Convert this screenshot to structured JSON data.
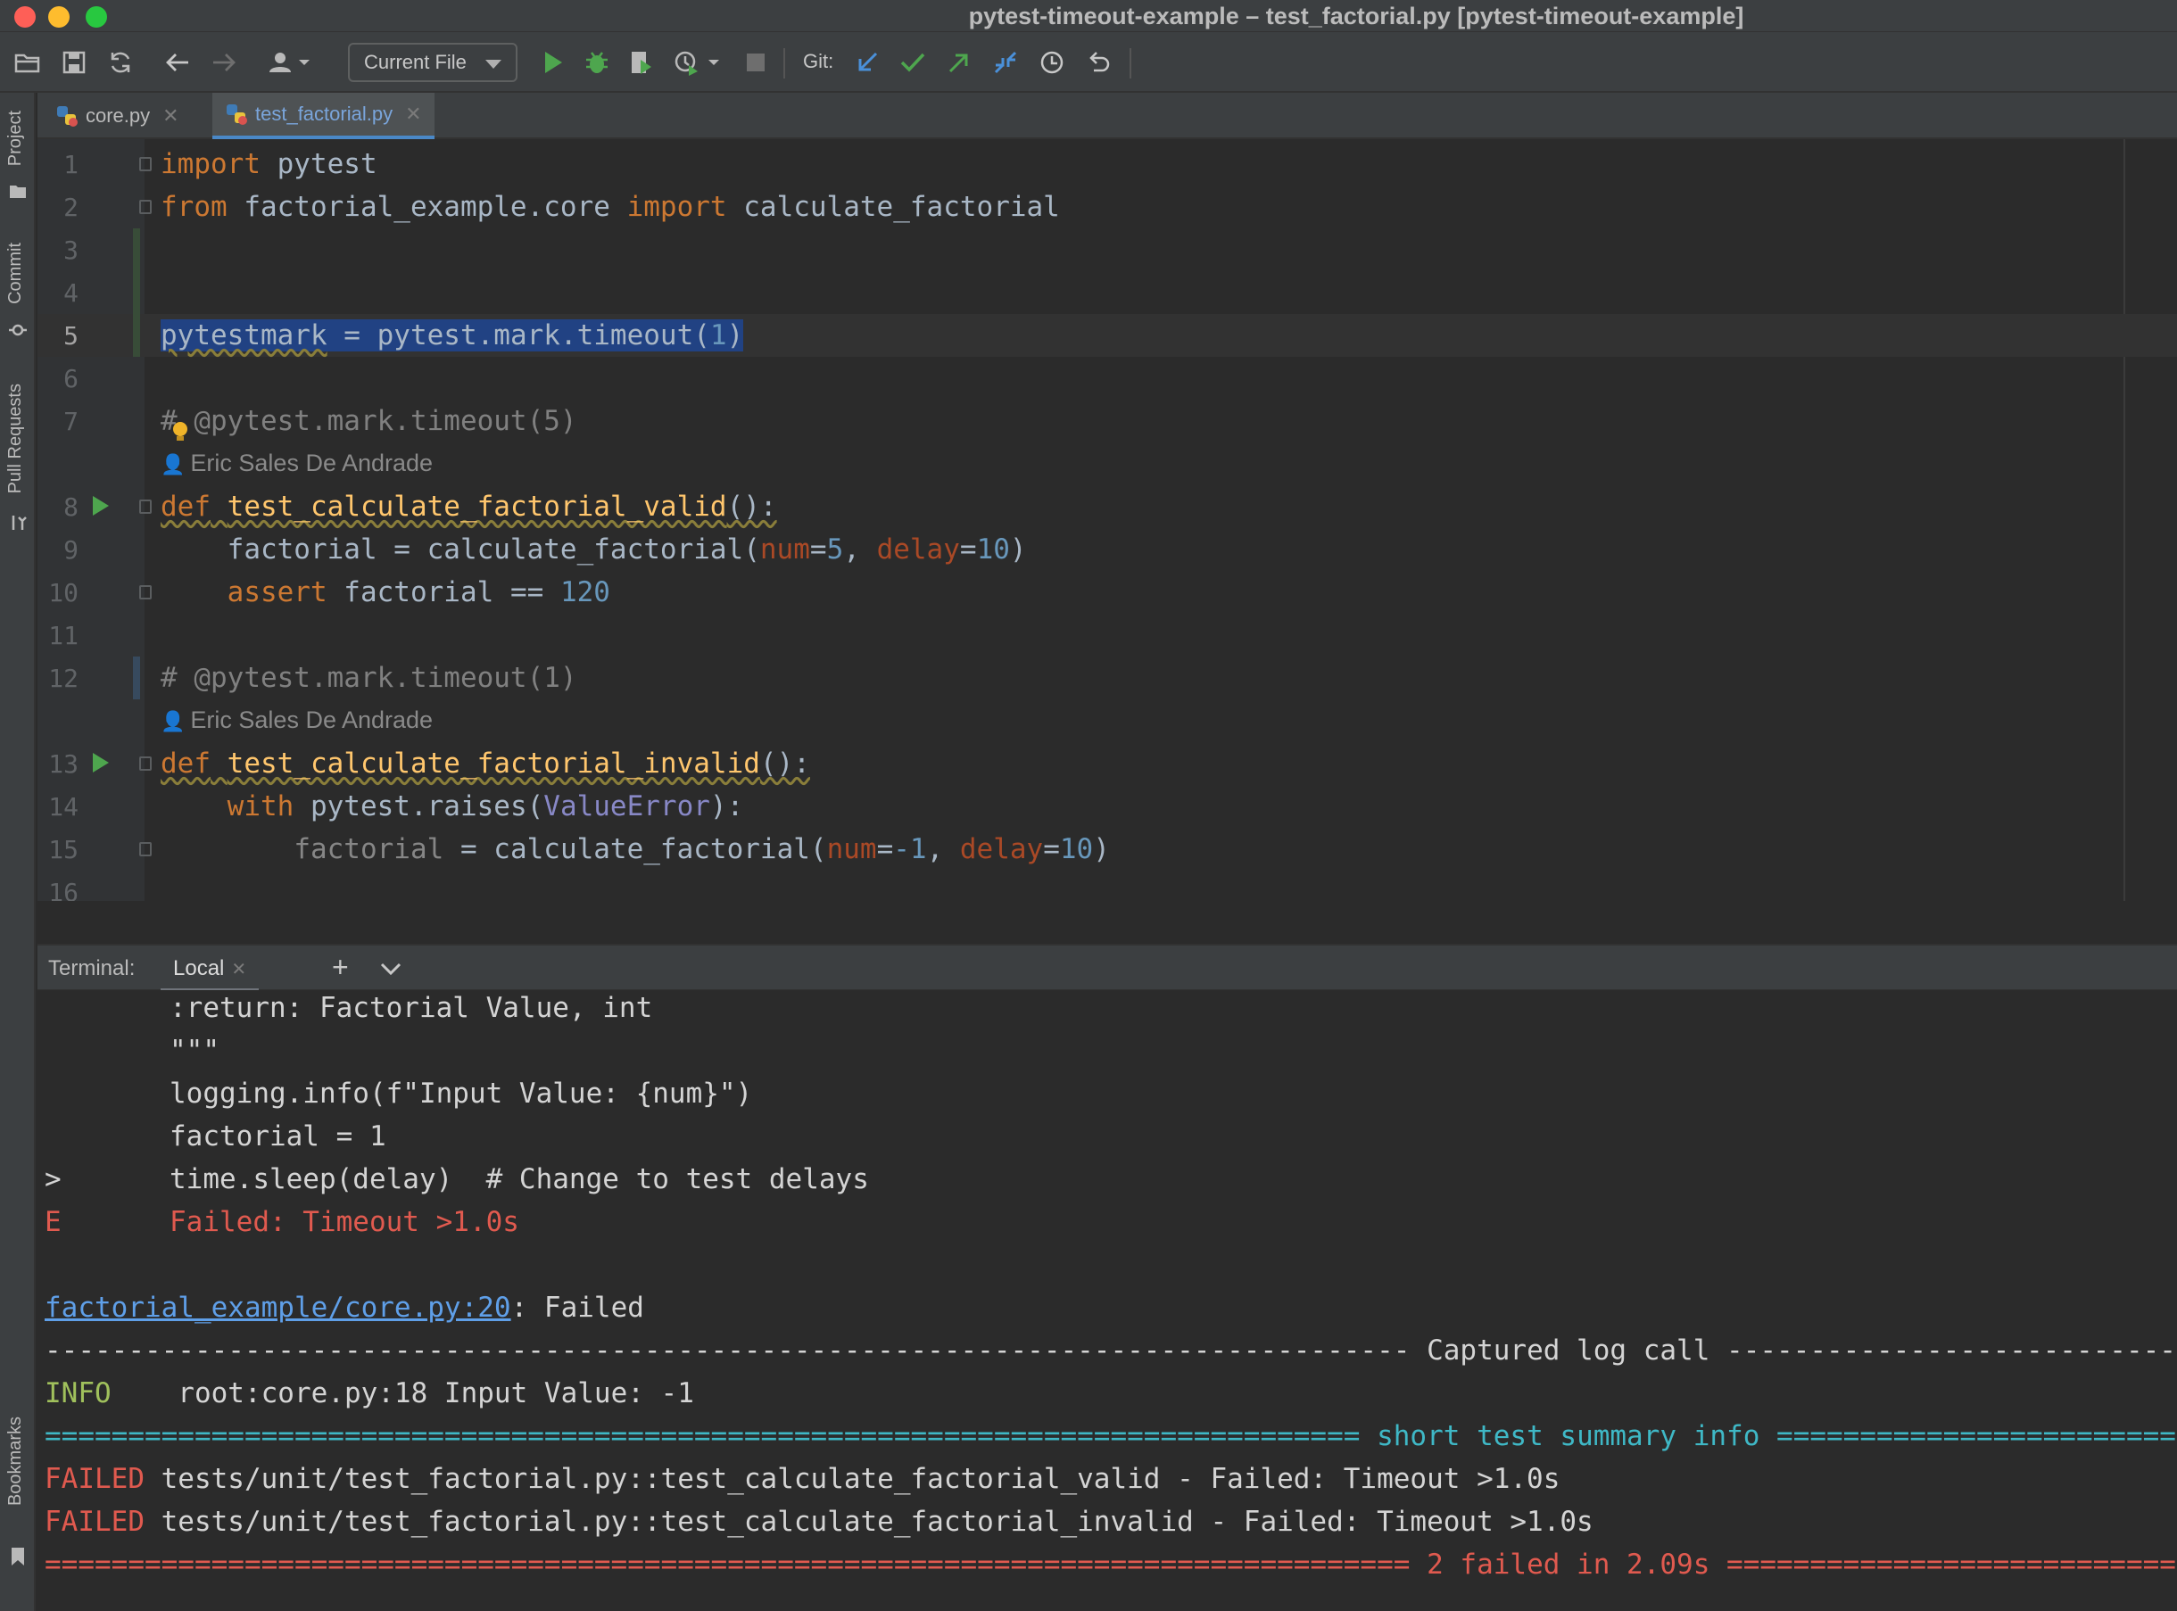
{
  "window": {
    "title": "pytest-timeout-example – test_factorial.py [pytest-timeout-example]"
  },
  "toolbar": {
    "run_config": "Current File",
    "git_label": "Git:"
  },
  "left_stripe": {
    "tabs": [
      "Project",
      "Commit",
      "Pull Requests",
      "Bookmarks"
    ]
  },
  "editor_tabs": [
    {
      "label": "core.py",
      "active": false
    },
    {
      "label": "test_factorial.py",
      "active": true
    }
  ],
  "editor": {
    "line_numbers": [
      "1",
      "2",
      "3",
      "4",
      "5",
      "6",
      "7",
      "8",
      "9",
      "10",
      "11",
      "12",
      "13",
      "14",
      "15",
      "16"
    ],
    "current_line": "5",
    "author_hint": "Eric Sales De Andrade",
    "code": {
      "l1": {
        "kw": "import",
        "rest": " pytest"
      },
      "l2": {
        "kw1": "from",
        "mod": " factorial_example.core ",
        "kw2": "import",
        "rest": " calculate_factorial"
      },
      "l5": {
        "var": "pytestmark",
        "mid": " = pytest.mark.timeout(",
        "num": "1",
        "end": ")"
      },
      "l7": "# @pytest.mark.timeout(5)",
      "l8": {
        "kw": "def",
        "name": "test_calculate_factorial_valid",
        "end": "():"
      },
      "l9": {
        "a": "    factorial = calculate_factorial(",
        "p1": "num",
        "eq1": "=",
        "v1": "5",
        "comma": ", ",
        "p2": "delay",
        "eq2": "=",
        "v2": "10",
        "end": ")"
      },
      "l10": {
        "kw": "    assert",
        "mid": " factorial == ",
        "num": "120"
      },
      "l12": "# @pytest.mark.timeout(1)",
      "l13": {
        "kw": "def",
        "name": "test_calculate_factorial_invalid",
        "end": "():"
      },
      "l14": {
        "kw": "    with",
        "mid": " pytest.raises(",
        "cls": "ValueError",
        "end": "):"
      },
      "l15": {
        "indent": "        ",
        "dim": "factorial",
        "a": " = calculate_factorial(",
        "p1": "num",
        "eq1": "=",
        "v1": "-1",
        "comma": ", ",
        "p2": "delay",
        "eq2": "=",
        "v2": "10",
        "end": ")"
      }
    }
  },
  "terminal": {
    "label": "Terminal:",
    "tab": "Local",
    "lines": {
      "t1": ":return: Factorial Value, int",
      "t2": "\"\"\"",
      "t3": "logging.info(f\"Input Value: {num}\")",
      "t4": "factorial = 1",
      "t5_prefix": ">",
      "t5": "time.sleep(delay)  # Change to test delays",
      "t6_prefix": "E",
      "t6": "Failed: Timeout >1.0s",
      "t8_link": "factorial_example/core.py:20",
      "t8_rest": ": Failed",
      "t9_title": " Captured log call ",
      "t10_level": "INFO",
      "t10_msg": "    root:core.py:18 Input Value: -1",
      "t11_title": " short test summary info ",
      "t12_tag": "FAILED",
      "t12_msg": " tests/unit/test_factorial.py::test_calculate_factorial_valid - Failed: Timeout >1.0s",
      "t13_tag": "FAILED",
      "t13_msg": " tests/unit/test_factorial.py::test_calculate_factorial_invalid - Failed: Timeout >1.0s",
      "t14_title": " 2 failed in 2.09s "
    }
  },
  "colors": {
    "keyword": "#cc7832",
    "function": "#ffc66d",
    "number": "#6897bb",
    "param": "#aa4926",
    "comment": "#808080",
    "fail": "#e05a4f",
    "info": "#a0c05c",
    "summary": "#3fb8c6",
    "link": "#5f9fe8"
  }
}
